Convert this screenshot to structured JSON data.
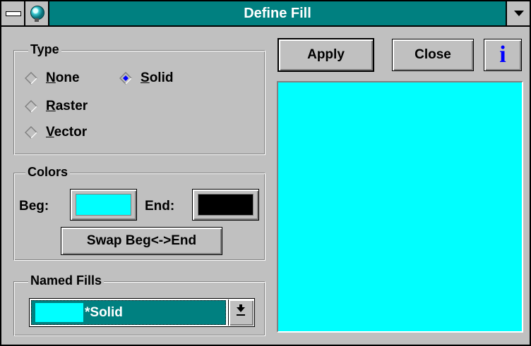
{
  "window": {
    "title": "Define Fill"
  },
  "type_group": {
    "legend": "Type",
    "options": [
      {
        "label_first": "N",
        "label_rest": "one",
        "selected": false
      },
      {
        "label_first": "S",
        "label_rest": "olid",
        "selected": true
      },
      {
        "label_first": "R",
        "label_rest": "aster",
        "selected": false
      },
      {
        "label_first": "V",
        "label_rest": "ector",
        "selected": false
      }
    ]
  },
  "colors_group": {
    "legend": "Colors",
    "beg_label": "Beg:",
    "end_label": "End:",
    "beg_color": "#00ffff",
    "end_color": "#000000",
    "swap_label": "Swap Beg<->End"
  },
  "named_fills_group": {
    "legend": "Named Fills",
    "selected_value": "*Solid",
    "selected_color": "#00ffff"
  },
  "buttons": {
    "apply": "Apply",
    "close": "Close",
    "info": "i"
  },
  "preview": {
    "fill_color": "#00ffff"
  },
  "icons": {
    "system_menu": "system-menu-icon",
    "app": "globe-icon",
    "window_menu": "dropdown-arrow-icon",
    "info": "info-icon"
  }
}
